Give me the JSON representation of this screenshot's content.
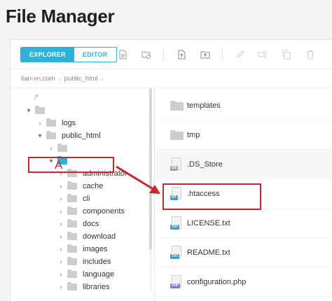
{
  "page": {
    "title": "File Manager"
  },
  "toolbar": {
    "explorer_label": "EXPLORER",
    "editor_label": "EDITOR",
    "accent": "#2bb3d9",
    "tools": [
      "file-info-icon",
      "folder-info-icon",
      "upload-file-icon",
      "upload-folder-icon",
      "edit-icon",
      "rename-icon",
      "copy-icon",
      "delete-icon"
    ]
  },
  "breadcrumb": {
    "items": [
      "lian-vn.com",
      "public_html"
    ]
  },
  "tree": {
    "rows": [
      {
        "label": "",
        "level": 0,
        "chevron": "▾",
        "icon": "folder"
      },
      {
        "label": "logs",
        "level": 1,
        "chevron": "›",
        "icon": "folder"
      },
      {
        "label": "public_html",
        "level": 1,
        "chevron": "▾",
        "icon": "folder"
      },
      {
        "label": "",
        "level": 2,
        "chevron": "›",
        "icon": "folder"
      },
      {
        "label": "",
        "level": 2,
        "chevron": "▾",
        "icon": "folder-blue"
      },
      {
        "label": "administrator",
        "level": 3,
        "chevron": "›",
        "icon": "folder"
      },
      {
        "label": "cache",
        "level": 3,
        "chevron": "›",
        "icon": "folder"
      },
      {
        "label": "cli",
        "level": 3,
        "chevron": "›",
        "icon": "folder"
      },
      {
        "label": "components",
        "level": 3,
        "chevron": "›",
        "icon": "folder"
      },
      {
        "label": "docs",
        "level": 3,
        "chevron": "›",
        "icon": "folder"
      },
      {
        "label": "download",
        "level": 3,
        "chevron": "›",
        "icon": "folder"
      },
      {
        "label": "images",
        "level": 3,
        "chevron": "›",
        "icon": "folder"
      },
      {
        "label": "includes",
        "level": 3,
        "chevron": "›",
        "icon": "folder"
      },
      {
        "label": "language",
        "level": 3,
        "chevron": "›",
        "icon": "folder"
      },
      {
        "label": "libraries",
        "level": 3,
        "chevron": "›",
        "icon": "folder"
      }
    ]
  },
  "files": {
    "rows": [
      {
        "name": "templates",
        "type": "folder"
      },
      {
        "name": "tmp",
        "type": "folder"
      },
      {
        "name": ".DS_Store",
        "type": "file",
        "badge": "DS",
        "badge_color": "#9aa4ad"
      },
      {
        "name": ".htaccess",
        "type": "file",
        "badge": "HT",
        "badge_color": "#3aa0d8"
      },
      {
        "name": "LICENSE.txt",
        "type": "file",
        "badge": "TXT",
        "badge_color": "#3aa0d8"
      },
      {
        "name": "README.txt",
        "type": "file",
        "badge": "TXT",
        "badge_color": "#3aa0d8"
      },
      {
        "name": "configuration.php",
        "type": "file",
        "badge": "PHP",
        "badge_color": "#7b7fd6"
      }
    ]
  },
  "annotation": {
    "letter": "A",
    "color": "#c9262c"
  }
}
